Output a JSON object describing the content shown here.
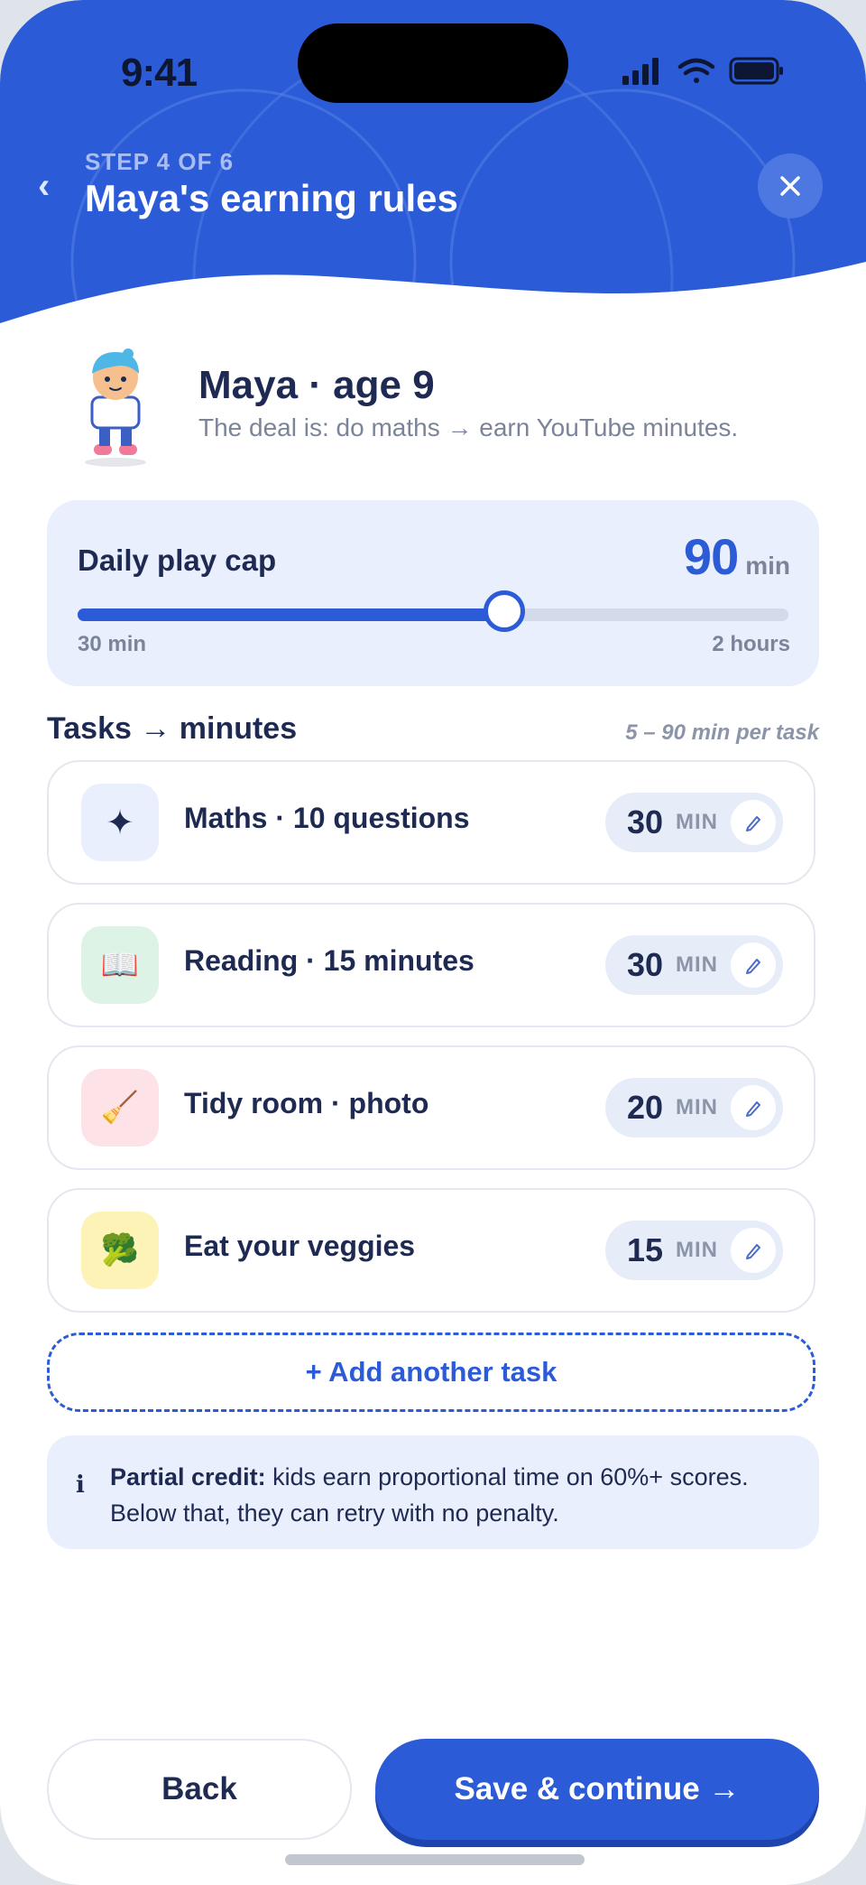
{
  "status_bar": {
    "time": "9:41",
    "icons": [
      "signal-icon",
      "wifi-icon",
      "battery-icon"
    ]
  },
  "header": {
    "step": "STEP 4 OF 6",
    "title": "Maya's earning rules",
    "back_icon": "chevron-left-icon",
    "close_icon": "close-icon"
  },
  "profile": {
    "name": "Maya · age 9",
    "subtitle": "The deal is: do maths → earn YouTube minutes."
  },
  "play_cap": {
    "label": "Daily play cap",
    "value": "90",
    "unit": "min",
    "min_label": "30 min",
    "max_label": "2 hours",
    "slider_fraction": 0.6
  },
  "tasks": {
    "heading": "Tasks → minutes",
    "hint": "5 – 90 min per task",
    "unit_label": "MIN",
    "items": [
      {
        "label": "Maths · 10 questions",
        "minutes": "30",
        "icon": "sparkle-icon",
        "glyph": "✦",
        "icon_bg": "#e9effd"
      },
      {
        "label": "Reading · 15 minutes",
        "minutes": "30",
        "icon": "book-icon",
        "glyph": "📖",
        "icon_bg": "#dcf3e6"
      },
      {
        "label": "Tidy room · photo",
        "minutes": "20",
        "icon": "broom-icon",
        "glyph": "🧹",
        "icon_bg": "#fde3e8"
      },
      {
        "label": "Eat your veggies",
        "minutes": "15",
        "icon": "broccoli-icon",
        "glyph": "🥦",
        "icon_bg": "#fdf3b6"
      }
    ]
  },
  "add_task": {
    "label": "+ Add another task"
  },
  "note": {
    "icon": "info-icon",
    "icon_glyph": "i",
    "strong": "Partial credit:",
    "text": " kids earn proportional time on 60%+ scores. Below that, they can retry with no penalty."
  },
  "footer": {
    "back_label": "Back",
    "save_label": "Save & continue →"
  },
  "colors": {
    "brand": "#2b5bd7",
    "ink": "#1e2a52",
    "muted": "#7b8499",
    "soft_blue": "#e9effd"
  }
}
